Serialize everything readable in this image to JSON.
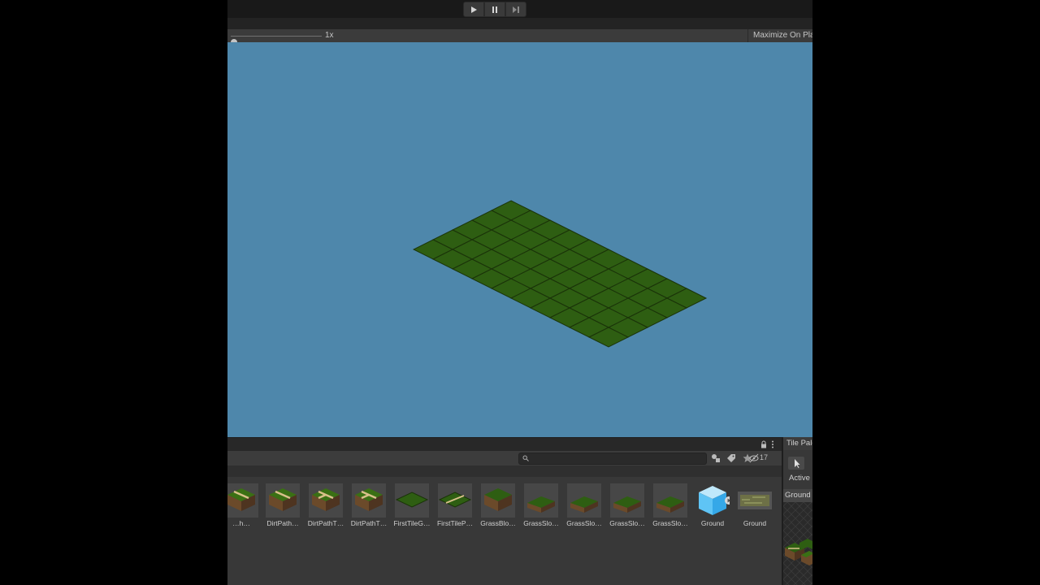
{
  "game_view": {
    "scale_label": "1x",
    "maximize_label": "Maximize On Play",
    "background_color": "#4e87ab",
    "tile_color": "#2e5e12",
    "tile_edge_color": "#1a3309",
    "grid_cols": 10,
    "grid_rows": 5
  },
  "project": {
    "hidden_count": "17",
    "assets": [
      {
        "label": "…h…",
        "icon": "dirt-path-tile-icon"
      },
      {
        "label": "DirtPath…",
        "icon": "dirt-path-tile-icon"
      },
      {
        "label": "DirtPathT…",
        "icon": "dirt-path-t-tile-icon"
      },
      {
        "label": "DirtPathT…",
        "icon": "dirt-path-t-tile-icon"
      },
      {
        "label": "FirstTileG…",
        "icon": "flat-grass-tile-icon"
      },
      {
        "label": "FirstTileP…",
        "icon": "flat-path-tile-icon"
      },
      {
        "label": "GrassBlo…",
        "icon": "grass-block-tile-icon"
      },
      {
        "label": "GrassSlo…",
        "icon": "grass-slope-tile-icon"
      },
      {
        "label": "GrassSlo…",
        "icon": "grass-slope-tile-icon"
      },
      {
        "label": "GrassSlo…",
        "icon": "grass-slope-tile-icon"
      },
      {
        "label": "GrassSlo…",
        "icon": "grass-slope-tile-icon"
      },
      {
        "label": "Ground",
        "icon": "prefab-cube-icon"
      },
      {
        "label": "Ground",
        "icon": "palette-asset-icon"
      }
    ]
  },
  "palette": {
    "tab_label": "Tile Palette",
    "active_label": "Active",
    "ground_label": "Ground"
  }
}
